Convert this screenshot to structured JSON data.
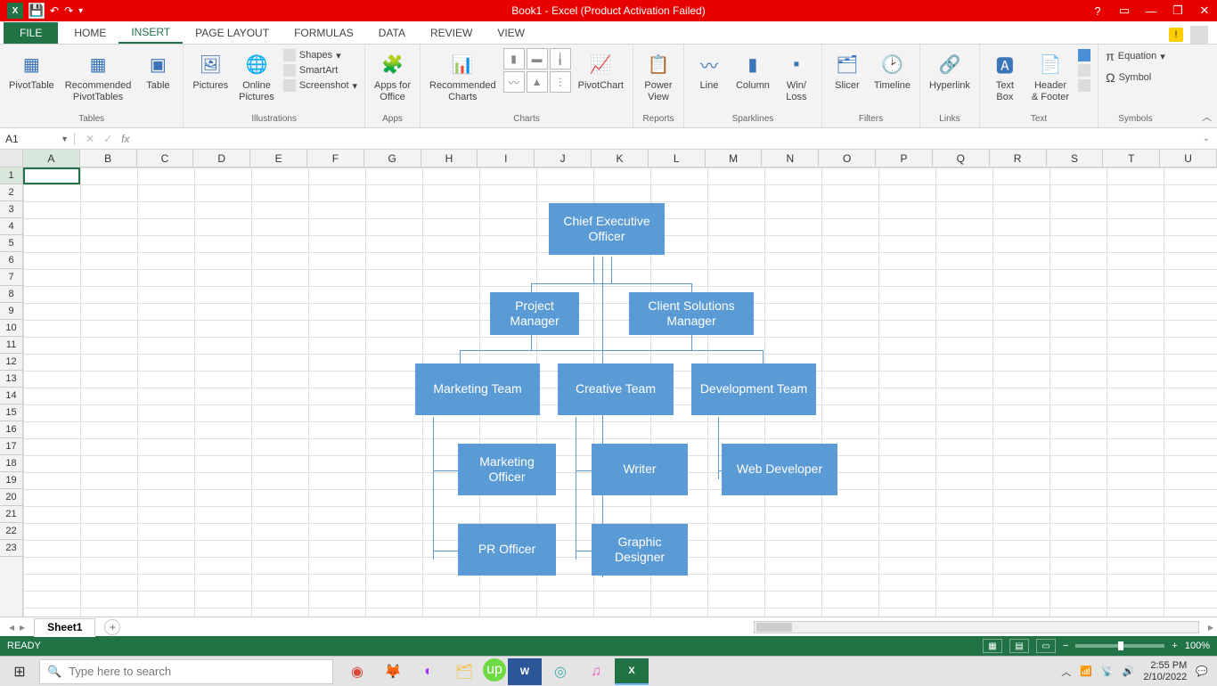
{
  "titlebar": {
    "title": "Book1 - Excel (Product Activation Failed)"
  },
  "tabs": {
    "file": "FILE",
    "items": [
      "HOME",
      "INSERT",
      "PAGE LAYOUT",
      "FORMULAS",
      "DATA",
      "REVIEW",
      "VIEW"
    ],
    "active": "INSERT"
  },
  "ribbon": {
    "groups": {
      "tables": {
        "label": "Tables",
        "pivottable": "PivotTable",
        "recommended_pt": "Recommended\nPivotTables",
        "table": "Table"
      },
      "illustrations": {
        "label": "Illustrations",
        "pictures": "Pictures",
        "online_pictures": "Online\nPictures",
        "shapes": "Shapes",
        "smartart": "SmartArt",
        "screenshot": "Screenshot"
      },
      "apps": {
        "label": "Apps",
        "apps_for_office": "Apps for\nOffice"
      },
      "charts": {
        "label": "Charts",
        "recommended": "Recommended\nCharts",
        "pivotchart": "PivotChart"
      },
      "reports": {
        "label": "Reports",
        "powerview": "Power\nView"
      },
      "sparklines": {
        "label": "Sparklines",
        "line": "Line",
        "column": "Column",
        "winloss": "Win/\nLoss"
      },
      "filters": {
        "label": "Filters",
        "slicer": "Slicer",
        "timeline": "Timeline"
      },
      "links": {
        "label": "Links",
        "hyperlink": "Hyperlink"
      },
      "text": {
        "label": "Text",
        "textbox": "Text\nBox",
        "header_footer": "Header\n& Footer"
      },
      "symbols": {
        "label": "Symbols",
        "equation": "Equation",
        "symbol": "Symbol"
      }
    }
  },
  "namebox": {
    "ref": "A1"
  },
  "columns": [
    "A",
    "B",
    "C",
    "D",
    "E",
    "F",
    "G",
    "H",
    "I",
    "J",
    "K",
    "L",
    "M",
    "N",
    "O",
    "P",
    "Q",
    "R",
    "S",
    "T",
    "U"
  ],
  "rows": [
    "1",
    "2",
    "3",
    "4",
    "5",
    "6",
    "7",
    "8",
    "9",
    "10",
    "11",
    "12",
    "13",
    "14",
    "15",
    "16",
    "17",
    "18",
    "19",
    "20",
    "21",
    "22",
    "23"
  ],
  "sheet": {
    "name": "Sheet1"
  },
  "status": {
    "ready": "READY",
    "zoom": "100%"
  },
  "taskbar": {
    "search_placeholder": "Type here to search",
    "time": "2:55 PM",
    "date": "2/10/2022"
  },
  "chart_data": {
    "type": "org-hierarchy",
    "nodes": [
      {
        "id": "ceo",
        "label": "Chief Executive Officer",
        "children": [
          "pm",
          "csm"
        ]
      },
      {
        "id": "pm",
        "label": "Project Manager"
      },
      {
        "id": "csm",
        "label": "Client Solutions Manager"
      },
      {
        "id": "mt",
        "label": "Marketing Team",
        "parents": [
          "pm",
          "csm"
        ],
        "children": [
          "mo",
          "pr"
        ]
      },
      {
        "id": "ct",
        "label": "Creative Team",
        "parents": [
          "pm",
          "csm"
        ],
        "children": [
          "writer",
          "gd"
        ]
      },
      {
        "id": "dt",
        "label": "Development Team",
        "parents": [
          "pm",
          "csm"
        ],
        "children": [
          "wd"
        ]
      },
      {
        "id": "mo",
        "label": "Marketing Officer"
      },
      {
        "id": "pr",
        "label": "PR Officer"
      },
      {
        "id": "writer",
        "label": "Writer"
      },
      {
        "id": "gd",
        "label": "Graphic Designer"
      },
      {
        "id": "wd",
        "label": "Web Developer"
      }
    ]
  }
}
